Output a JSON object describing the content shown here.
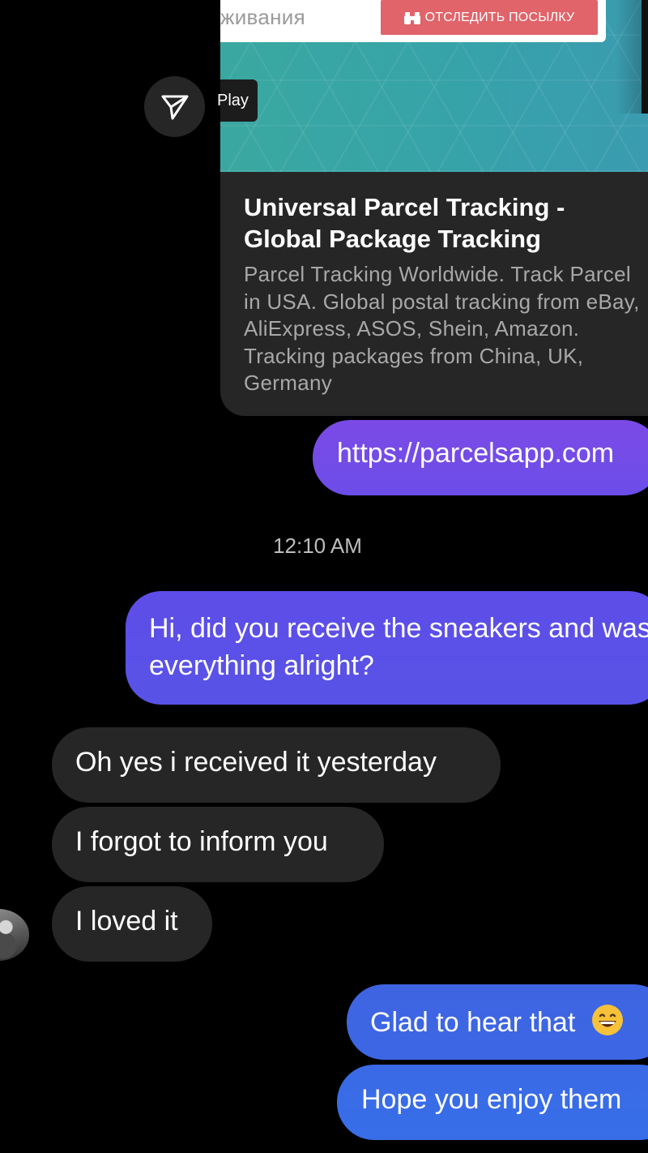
{
  "link_preview": {
    "header_partial_text": "живания",
    "track_button_label": "ОТСЛЕДИТЬ ПОСЫЛКУ",
    "play_label": "Play",
    "title": "Universal Parcel Tracking - Global Package Tracking",
    "description": "Parcel Tracking Worldwide. Track Parcel in USA. Global postal tracking from eBay, AliExpress, ASOS, Shein, Amazon. Tracking packages from China, UK, Germany"
  },
  "messages": {
    "url": "https://parcelsapp.com",
    "timestamp": "12:10 AM",
    "sent_question": "Hi, did you receive the sneakers and was everything alright?",
    "received": [
      "Oh yes i received it yesterday",
      "I forgot to inform you",
      "I loved it"
    ],
    "sent_reply_1": "Glad to hear that",
    "sent_reply_2": "Hope you enjoy them"
  },
  "icons": {
    "share": "paper-plane-icon",
    "binoculars": "binoculars-icon",
    "emoji": "grinning-face-emoji"
  },
  "colors": {
    "background": "#000000",
    "received_bubble": "#262626",
    "sent_purple": "#6c4de8",
    "sent_blue": "#3b6ae6",
    "track_button": "#e0646a"
  }
}
